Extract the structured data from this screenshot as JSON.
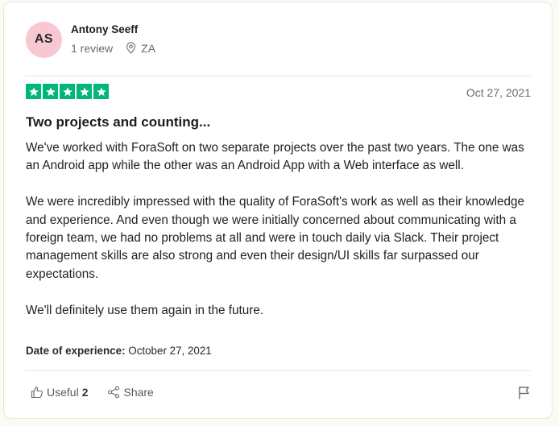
{
  "reviewer": {
    "initials": "AS",
    "name": "Antony Seeff",
    "reviews": "1 review",
    "location": "ZA"
  },
  "review": {
    "rating_stars": 5,
    "date": "Oct 27, 2021",
    "title": "Two projects and counting...",
    "paragraphs": [
      "We've worked with ForaSoft on two separate projects over the past two years. The one was an Android app while the other was an Android App with a Web interface as well.",
      "We were incredibly impressed with the quality of ForaSoft's work as well as their knowledge and experience. And even though we were initially concerned about communicating with a foreign team, we had no problems at all and were in touch daily via Slack. Their project management skills are also strong and even their design/UI skills far surpassed our expectations.",
      "We'll definitely use them again in the future."
    ],
    "experience_label": "Date of experience:",
    "experience_date": "October 27, 2021"
  },
  "actions": {
    "useful_label": "Useful",
    "useful_count": "2",
    "share_label": "Share"
  },
  "icons": {
    "location": "location-pin-icon",
    "star": "star-icon",
    "useful": "thumbs-up-icon",
    "share": "share-icon",
    "flag": "flag-icon"
  },
  "colors": {
    "star_fill": "#00b67a",
    "avatar_bg": "#f7c7d2",
    "page_bg": "#fcfbf3"
  }
}
